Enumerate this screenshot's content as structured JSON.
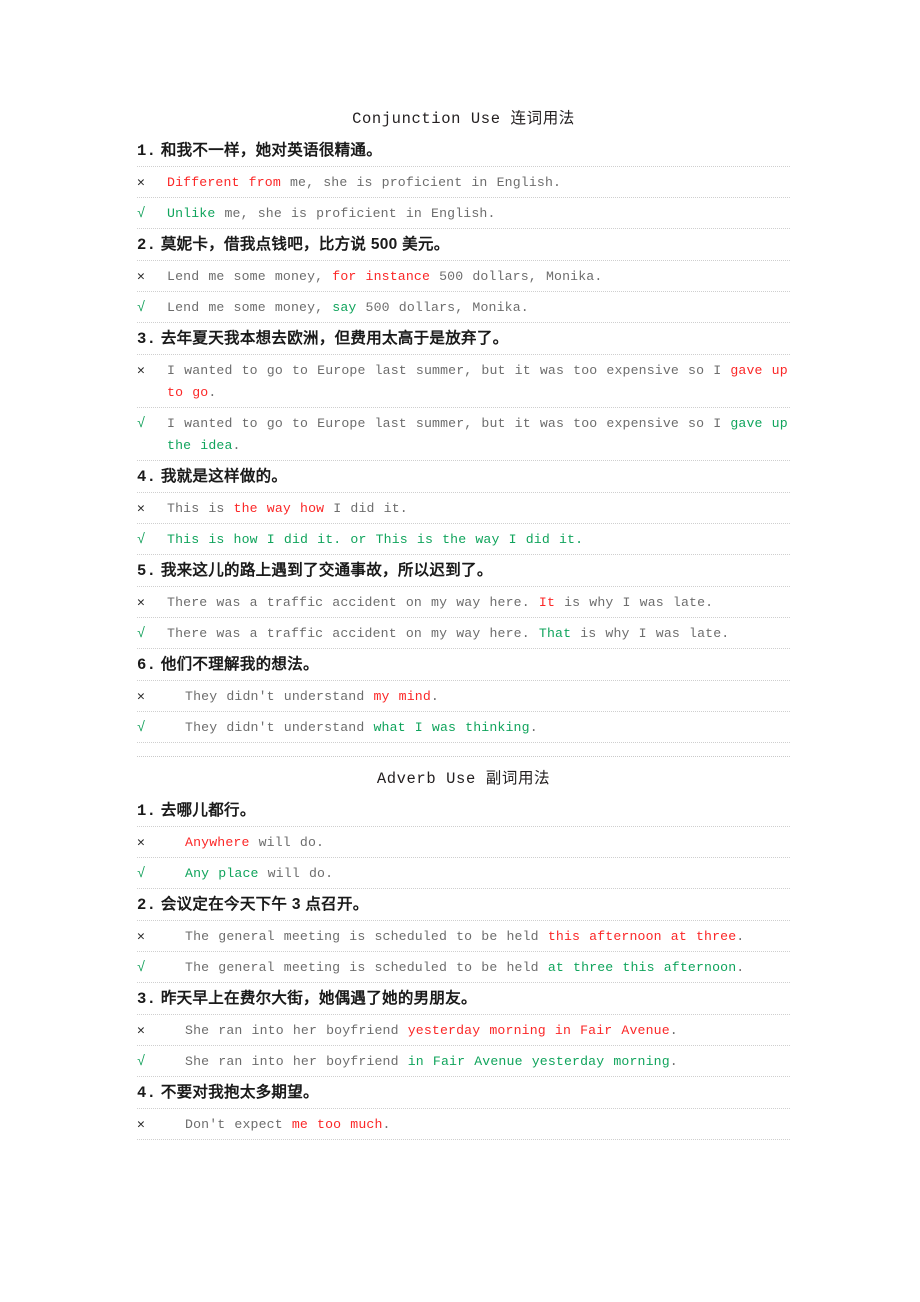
{
  "document": {
    "sections": [
      {
        "id": "conjunction",
        "title": "Conjunction Use 连词用法",
        "items": [
          {
            "number": "1.",
            "chinese": "和我不一样，她对英语很精通。",
            "wrong_mark": "✕",
            "right_mark": "√",
            "wrong": {
              "pre": "",
              "hl": "Different from",
              "post": "  me, she is proficient in English."
            },
            "right": {
              "pre": "",
              "hl": "Unlike",
              "post": "  me, she is proficient in English."
            }
          },
          {
            "number": "2.",
            "chinese": "莫妮卡，借我点钱吧，比方说 500 美元。",
            "wrong_mark": "✕",
            "right_mark": "√",
            "wrong": {
              "pre": "Lend me some money,  ",
              "hl": "for instance",
              "post": "  500 dollars, Monika."
            },
            "right": {
              "pre": "Lend me some money,  ",
              "hl": "say",
              "post": "  500 dollars, Monika."
            }
          },
          {
            "number": "3.",
            "chinese": "去年夏天我本想去欧洲，但费用太高于是放弃了。",
            "wrong_mark": "✕",
            "right_mark": "√",
            "wrong": {
              "pre": "I wanted to go to Europe last summer, but it was too expensive so I  ",
              "hl": "gave up to go",
              "post": "."
            },
            "right": {
              "pre": "I wanted to go to Europe last summer, but it was too expensive so I  ",
              "hl": "gave up the idea",
              "post": "."
            }
          },
          {
            "number": "4.",
            "chinese": "我就是这样做的。",
            "wrong_mark": "✕",
            "right_mark": "√",
            "wrong": {
              "pre": "This is  ",
              "hl": "the way how",
              "post": "  I did it."
            },
            "right": {
              "pre": "",
              "hl": "This is how I did it. or This is the way I did it.",
              "post": "",
              "all_green": true
            }
          },
          {
            "number": "5.",
            "chinese": "我来这儿的路上遇到了交通事故，所以迟到了。",
            "wrong_mark": "✕",
            "right_mark": "√",
            "wrong": {
              "pre": "There was a traffic accident on my way here.  ",
              "hl": "It",
              "post": "  is why I was late."
            },
            "right": {
              "pre": "There was a traffic accident on my way here.  ",
              "hl": "That",
              "post": "  is why I was late."
            }
          },
          {
            "number": "6.",
            "chinese": "他们不理解我的想法。",
            "wrong_mark": "✕",
            "right_mark": "√",
            "indent": true,
            "wrong": {
              "pre": "They didn't understand  ",
              "hl": "my mind",
              "post": "."
            },
            "right": {
              "pre": "They didn't understand  ",
              "hl": "what I was thinking",
              "post": "."
            }
          }
        ]
      },
      {
        "id": "adverb",
        "title": "Adverb Use 副词用法",
        "items": [
          {
            "number": "1.",
            "chinese": "去哪儿都行。",
            "wrong_mark": "✕",
            "right_mark": "√",
            "indent": true,
            "wrong": {
              "pre": "",
              "hl": "Anywhere",
              "post": "  will do."
            },
            "right": {
              "pre": "",
              "hl": "Any place",
              "post": "  will do."
            }
          },
          {
            "number": "2.",
            "chinese": "会议定在今天下午 3 点召开。",
            "wrong_mark": "✕",
            "right_mark": "√",
            "indent": true,
            "wrong": {
              "pre": "The general meeting is scheduled to be held  ",
              "hl": "this afternoon at three",
              "post": "."
            },
            "right": {
              "pre": "The general meeting is scheduled to be held  ",
              "hl": "at three this afternoon",
              "post": "."
            }
          },
          {
            "number": "3.",
            "chinese": "昨天早上在费尔大街，她偶遇了她的男朋友。",
            "wrong_mark": "✕",
            "right_mark": "√",
            "indent": true,
            "wrong": {
              "pre": "She ran into her boyfriend  ",
              "hl": "yesterday morning in Fair Avenue",
              "post": "."
            },
            "right": {
              "pre": "She ran into her boyfriend  ",
              "hl": "in Fair Avenue yesterday morning",
              "post": "."
            }
          },
          {
            "number": "4.",
            "chinese": "不要对我抱太多期望。",
            "wrong_mark": "✕",
            "right_mark": "√",
            "indent": true,
            "wrong": {
              "pre": "Don't expect  ",
              "hl": "me  too much",
              "post": "."
            }
          }
        ]
      }
    ]
  },
  "colors": {
    "wrong_highlight": "#fb2727",
    "right_highlight": "#10a45c",
    "body_text": "#6d6d6d",
    "heading_text": "#1a1a1a",
    "check_mark": "#12a05a",
    "cross_mark": "#2b2b2b",
    "rule": "#cfcfcf"
  }
}
